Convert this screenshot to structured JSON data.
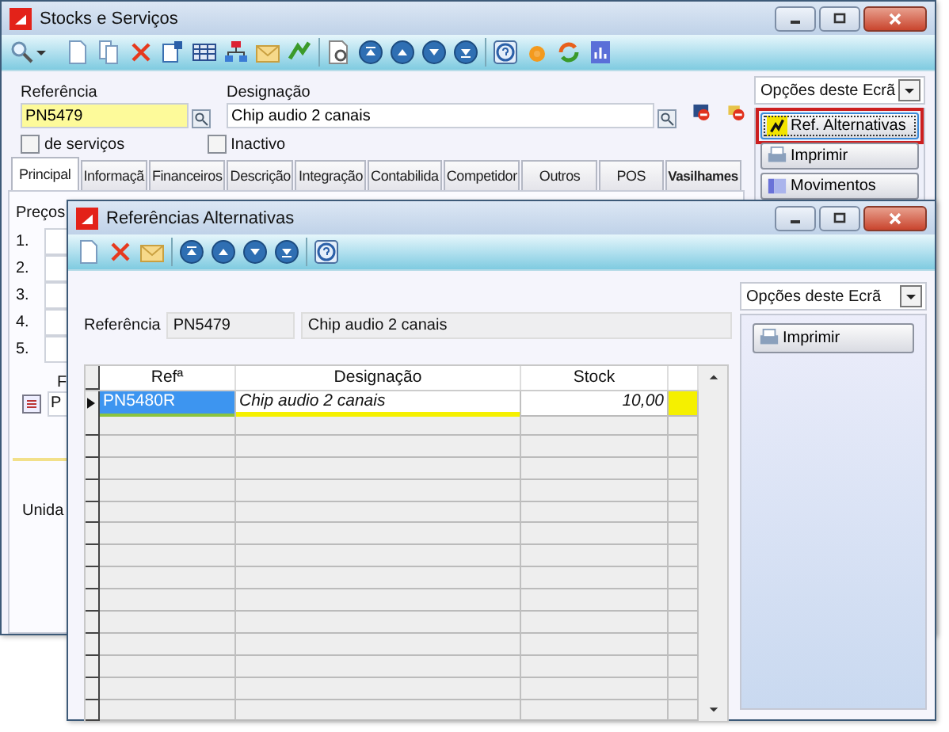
{
  "main_window": {
    "title": "Stocks e Serviços",
    "reference": {
      "label": "Referência",
      "value": "PN5479"
    },
    "designation": {
      "label": "Designação",
      "value": "Chip audio 2 canais"
    },
    "checkboxes": [
      {
        "label": "de serviços",
        "checked": false
      },
      {
        "label": "Inactivo",
        "checked": false
      }
    ],
    "tabs": [
      {
        "label": "Principal",
        "selected": true
      },
      {
        "label": "Informaçã",
        "selected": false
      },
      {
        "label": "Financeiros",
        "selected": false
      },
      {
        "label": "Descrição",
        "selected": false
      },
      {
        "label": "Integração",
        "selected": false
      },
      {
        "label": "Contabilida",
        "selected": false
      },
      {
        "label": "Competidor",
        "selected": false
      },
      {
        "label": "Outros",
        "selected": false
      },
      {
        "label": "POS",
        "selected": false
      },
      {
        "label": "Vasilhames",
        "selected": false
      }
    ],
    "prices": {
      "label": "Preços",
      "rows": [
        "1.",
        "2.",
        "3.",
        "4.",
        "5."
      ]
    },
    "field_label": "F",
    "field_value": "P",
    "units_label": "Unida",
    "screen_options": "Opções deste Ecrã",
    "actions": [
      {
        "label": "Ref. Alternativas",
        "selected": true
      },
      {
        "label": "Imprimir",
        "selected": false
      },
      {
        "label": "Movimentos",
        "selected": false
      }
    ]
  },
  "dialog": {
    "title": "Referências Alternativas",
    "reference": {
      "label": "Referência",
      "value": "PN5479",
      "designation": "Chip audio 2 canais"
    },
    "screen_options": "Opções deste Ecrã",
    "actions": [
      {
        "label": "Imprimir"
      }
    ],
    "table": {
      "columns": [
        "Refª",
        "Designação",
        "Stock"
      ],
      "rows": [
        {
          "ref": "PN5480R",
          "designation": "Chip audio 2 canais",
          "stock": "10,00",
          "selected": true
        }
      ]
    }
  }
}
